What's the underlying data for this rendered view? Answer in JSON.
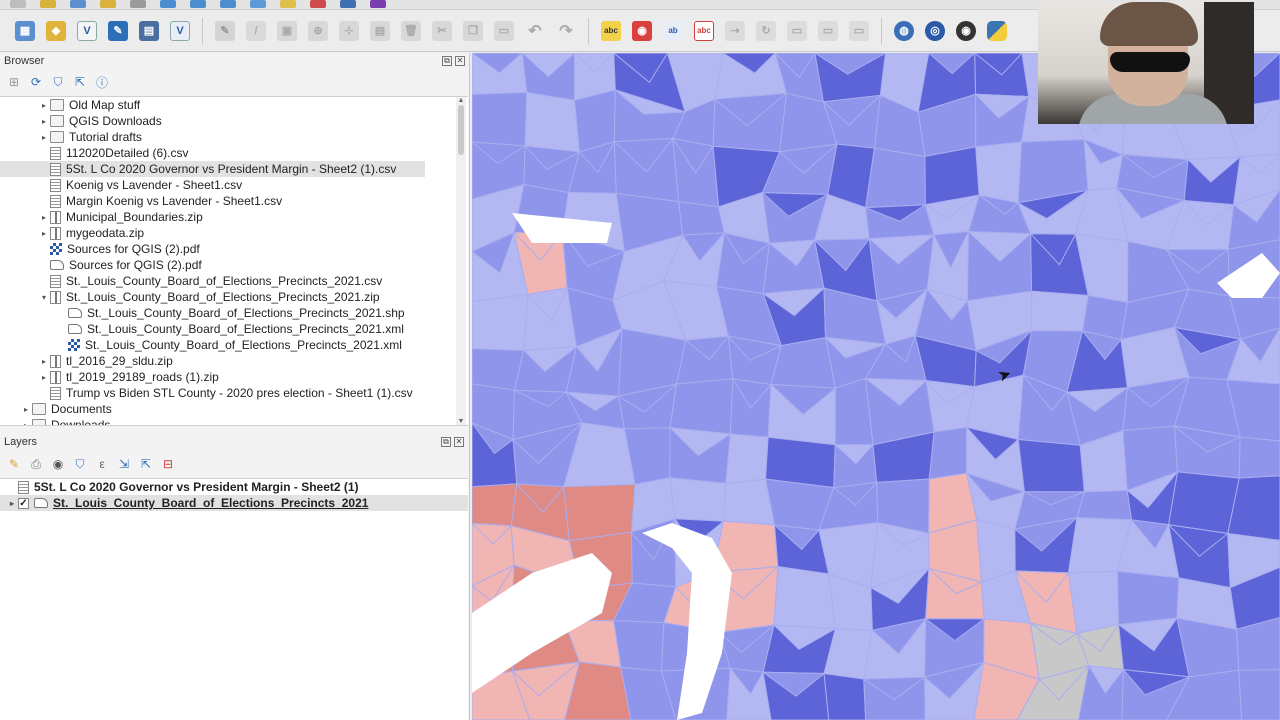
{
  "browser": {
    "title": "Browser",
    "items": [
      {
        "label": "Old Map stuff",
        "type": "folder",
        "arrow": "▸",
        "indent": 2
      },
      {
        "label": "QGIS Downloads",
        "type": "folder",
        "arrow": "▸",
        "indent": 2
      },
      {
        "label": "Tutorial drafts",
        "type": "folder",
        "arrow": "▸",
        "indent": 2
      },
      {
        "label": "112020Detailed (6).csv",
        "type": "csv",
        "arrow": "",
        "indent": 2
      },
      {
        "label": "5St. L Co 2020 Governor vs President Margin - Sheet2 (1).csv",
        "type": "csv",
        "arrow": "",
        "indent": 2,
        "selected": true
      },
      {
        "label": "Koenig vs Lavender - Sheet1.csv",
        "type": "csv",
        "arrow": "",
        "indent": 2
      },
      {
        "label": "Margin Koenig vs Lavender - Sheet1.csv",
        "type": "csv",
        "arrow": "",
        "indent": 2
      },
      {
        "label": "Municipal_Boundaries.zip",
        "type": "zip",
        "arrow": "▸",
        "indent": 2
      },
      {
        "label": "mygeodata.zip",
        "type": "zip",
        "arrow": "▸",
        "indent": 2
      },
      {
        "label": "Sources for QGIS (2).pdf",
        "type": "pdf",
        "arrow": "",
        "indent": 2
      },
      {
        "label": "Sources for QGIS (2).pdf",
        "type": "vec",
        "arrow": "",
        "indent": 2
      },
      {
        "label": "St._Louis_County_Board_of_Elections_Precincts_2021.csv",
        "type": "csv",
        "arrow": "",
        "indent": 2
      },
      {
        "label": "St._Louis_County_Board_of_Elections_Precincts_2021.zip",
        "type": "zip",
        "arrow": "▾",
        "indent": 2
      },
      {
        "label": "St._Louis_County_Board_of_Elections_Precincts_2021.shp",
        "type": "vec",
        "arrow": "",
        "indent": 3
      },
      {
        "label": "St._Louis_County_Board_of_Elections_Precincts_2021.xml",
        "type": "vec",
        "arrow": "",
        "indent": 3
      },
      {
        "label": "St._Louis_County_Board_of_Elections_Precincts_2021.xml",
        "type": "pdf",
        "arrow": "",
        "indent": 3
      },
      {
        "label": "tl_2016_29_sldu.zip",
        "type": "zip",
        "arrow": "▸",
        "indent": 2
      },
      {
        "label": "tl_2019_29189_roads (1).zip",
        "type": "zip",
        "arrow": "▸",
        "indent": 2
      },
      {
        "label": "Trump vs Biden STL County - 2020 pres election - Sheet1 (1).csv",
        "type": "csv",
        "arrow": "",
        "indent": 2
      },
      {
        "label": "Documents",
        "type": "folder",
        "arrow": "▸",
        "indent": 1
      },
      {
        "label": "Downloads",
        "type": "folder",
        "arrow": "▸",
        "indent": 1
      }
    ]
  },
  "layers": {
    "title": "Layers",
    "items": [
      {
        "label": "5St. L Co 2020 Governor vs President Margin - Sheet2 (1)",
        "checked": false,
        "expandable": false,
        "underline": false
      },
      {
        "label": "St._Louis_County_Board_of_Elections_Precincts_2021",
        "checked": true,
        "expandable": true,
        "underline": true
      }
    ]
  },
  "colors": {
    "dem_dark": "#5c64d8",
    "dem_mid": "#8e95ea",
    "dem_light": "#b3b8f3",
    "rep_light": "#f1b5b3",
    "rep_mid": "#e08a86",
    "no_data": "#c8c8c8"
  }
}
